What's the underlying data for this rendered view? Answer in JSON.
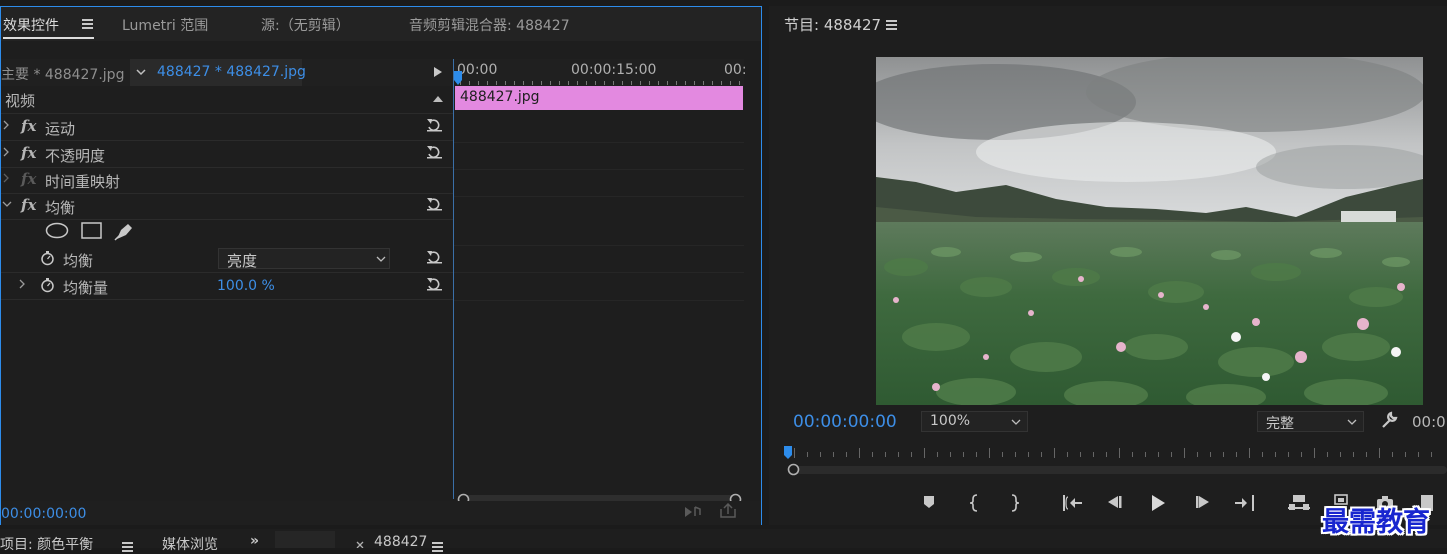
{
  "effect_controls": {
    "tabs": [
      {
        "label": "效果控件"
      },
      {
        "label": "Lumetri 范围"
      },
      {
        "label": "源:（无剪辑）"
      },
      {
        "label": "音频剪辑混合器: 488427"
      }
    ],
    "source_master": "主要 * 488427.jpg",
    "source_clip": "488427 * 488427.jpg",
    "section_video": "视频",
    "effects": [
      {
        "label": "运动",
        "fx_label": "fx"
      },
      {
        "label": "不透明度",
        "fx_label": "fx"
      },
      {
        "label": "时间重映射",
        "fx_label": "fx"
      },
      {
        "label": "均衡",
        "fx_label": "fx"
      }
    ],
    "param_equalize": {
      "label": "均衡",
      "value": "亮度"
    },
    "param_amount": {
      "label": "均衡量",
      "value": "100.0 %"
    },
    "timeline": {
      "time_start": "00:00",
      "time_mid": "00:00:15:00",
      "time_end": "00:",
      "clip_name": "488427.jpg"
    },
    "current_time": "00:00:00:00"
  },
  "program_monitor": {
    "title": "节目: 488427",
    "timecode": "00:00:00:00",
    "zoom": "100%",
    "quality": "完整",
    "timecode_right": "00:0"
  },
  "bottom_tabs": [
    {
      "label": "项目: 颜色平衡"
    },
    {
      "label": "媒体浏览"
    },
    {
      "label": "488427"
    }
  ],
  "watermark": "最需教育",
  "colors": {
    "accent": "#2d8ceb",
    "clip": "#e389e0",
    "timecode": "#3d8ee6"
  }
}
